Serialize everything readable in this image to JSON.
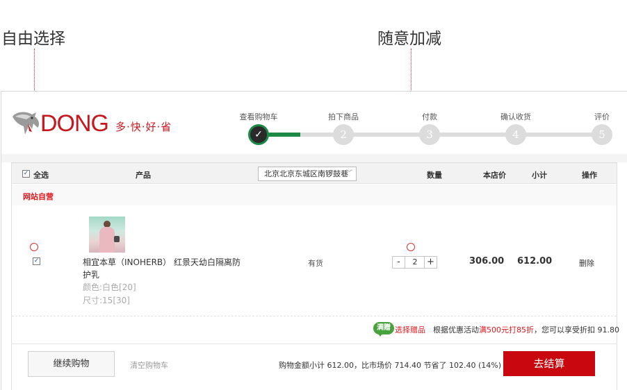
{
  "annotations": {
    "free_select": "自由选择",
    "free_add_subtract": "随意加减"
  },
  "logo": {
    "brand": "DONG",
    "slogan": "多·快·好·省"
  },
  "steps": [
    {
      "label": "查看购物车",
      "number": "✓",
      "state": "done"
    },
    {
      "label": "拍下商品",
      "number": "2",
      "state": "pending"
    },
    {
      "label": "付款",
      "number": "3",
      "state": "pending"
    },
    {
      "label": "确认收货",
      "number": "4",
      "state": "pending"
    },
    {
      "label": "评价",
      "number": "5",
      "state": "pending"
    }
  ],
  "table_header": {
    "select_all": "全选",
    "product": "产品",
    "address": "北京北京东城区南锣鼓巷",
    "quantity": "数量",
    "store_price": "本店价",
    "subtotal": "小计",
    "action": "操作"
  },
  "seller": {
    "label": "网站自营"
  },
  "item": {
    "name": "相宜本草（INOHERB） 红景天幼白隔离防护乳",
    "color": "颜色:白色[20]",
    "size": "尺寸:15[30]",
    "stock": "有货",
    "qty_minus": "-",
    "qty_value": "2",
    "qty_plus": "+",
    "price": "306.00",
    "subtotal": "612.00",
    "delete": "删除",
    "checked": true
  },
  "promo": {
    "badge": "满赠",
    "gift_link": "选择赠品",
    "text_prefix": "根据优惠活动",
    "text_highlight": "满500元打85折",
    "text_suffix": "，您可以享受折扣 91.80"
  },
  "footer": {
    "continue_shopping": "继续购物",
    "clear_cart": "清空购物车",
    "summary": "购物金额小计 612.00，比市场价 714.40 节省了 102.40 (14%)",
    "checkout": "去结算"
  },
  "colors": {
    "brand_red": "#c8161d",
    "checkout_red": "#c8080e",
    "progress_green": "#1a8a46",
    "badge_green": "#49a33c",
    "annotation_red": "#e03030"
  }
}
